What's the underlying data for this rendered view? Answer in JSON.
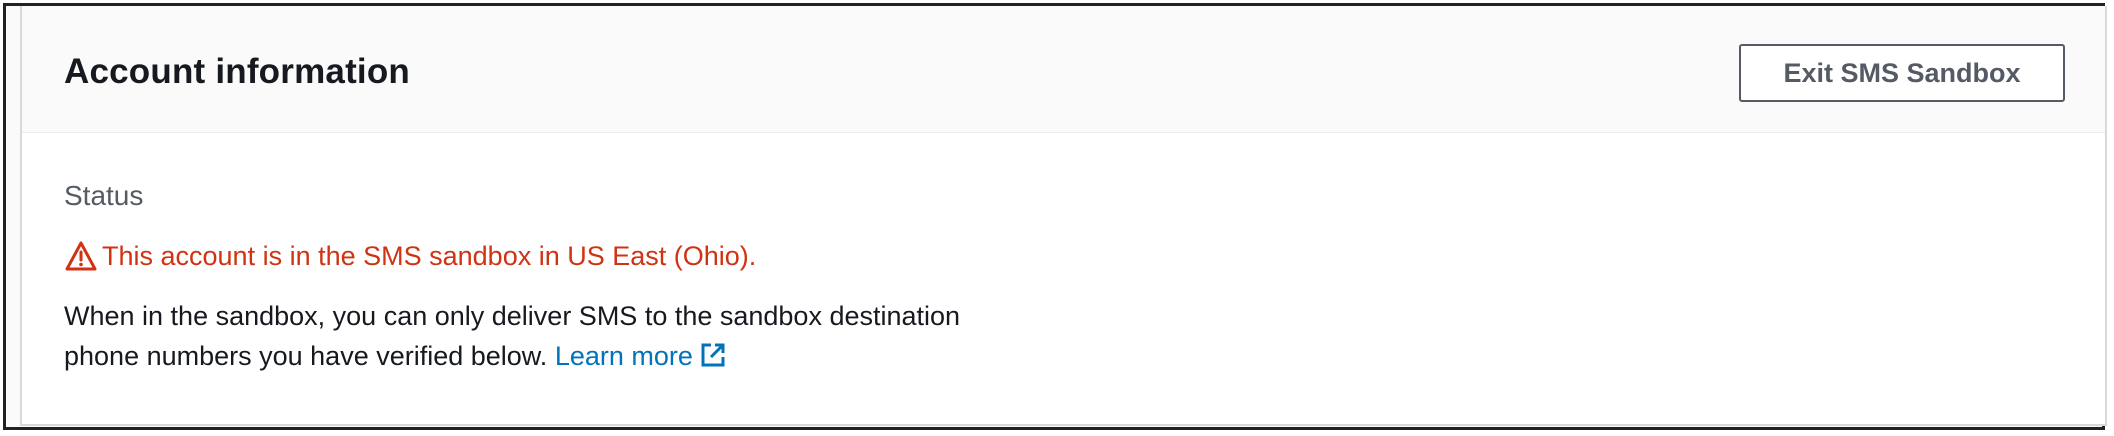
{
  "header": {
    "title": "Account information",
    "exit_button_label": "Exit SMS Sandbox"
  },
  "status": {
    "label": "Status",
    "warning_text": "This account is in the SMS sandbox in US East (Ohio).",
    "warning_icon": "warning-triangle-icon",
    "description_line1": "When in the sandbox, you can only deliver SMS to the sandbox destination",
    "description_line2": "phone numbers you have verified below.",
    "learn_more_label": "Learn more",
    "learn_more_icon": "external-link-icon"
  },
  "colors": {
    "warning": "#d13212",
    "link": "#0073bb",
    "text": "#16191f",
    "muted": "#545b64"
  }
}
